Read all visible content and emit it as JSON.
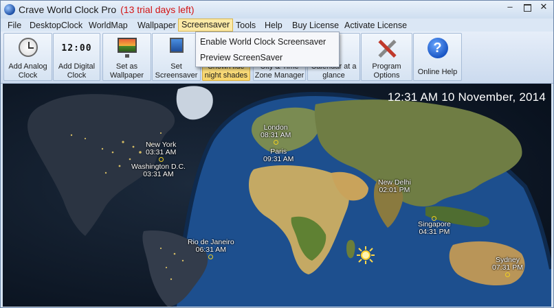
{
  "window": {
    "title": "Crave World Clock Pro",
    "trial": "(13 trial days left)",
    "minimize": "–",
    "close": "✕"
  },
  "menu": {
    "file": "File",
    "desktopclock": "DesktopClock",
    "worldmap": "WorldMap",
    "wallpaper": "Wallpaper",
    "screensaver": "Screensaver",
    "tools": "Tools",
    "help": "Help",
    "buy": "Buy License",
    "activate": "Activate License"
  },
  "toolbar": {
    "add_analog": [
      "Add Analog",
      "Clock"
    ],
    "add_digital": [
      "Add Digital",
      "Clock"
    ],
    "digital_glyph": "12:00",
    "set_wallpaper": [
      "Set as",
      "Wallpaper"
    ],
    "set_screensaver": [
      "Set",
      "Screensaver"
    ],
    "night_shades": [
      "Show/Hide",
      "night shades"
    ],
    "zone_manager": [
      "City & Time",
      "Zone Manager"
    ],
    "calendar": [
      "Calendar at a",
      "glance"
    ],
    "program_options": [
      "Program",
      "Options"
    ],
    "online_help": "Online Help"
  },
  "dropdown": {
    "enable": "Enable World Clock Screensaver",
    "preview": "Preview ScreenSaver"
  },
  "map": {
    "datetime": "12:31 AM 10 November, 2014",
    "cities": [
      {
        "name": "New York",
        "time": "03:31 AM"
      },
      {
        "name": "Washington D.C.",
        "time": "03:31 AM"
      },
      {
        "name": "London",
        "time": "08:31 AM"
      },
      {
        "name": "Paris",
        "time": "09:31 AM"
      },
      {
        "name": "New Delhi",
        "time": "02:01 PM"
      },
      {
        "name": "Singapore",
        "time": "04:31 PM"
      },
      {
        "name": "Rio de Janeiro",
        "time": "06:31 AM"
      },
      {
        "name": "Sydney",
        "time": "07:31 PM"
      }
    ]
  }
}
